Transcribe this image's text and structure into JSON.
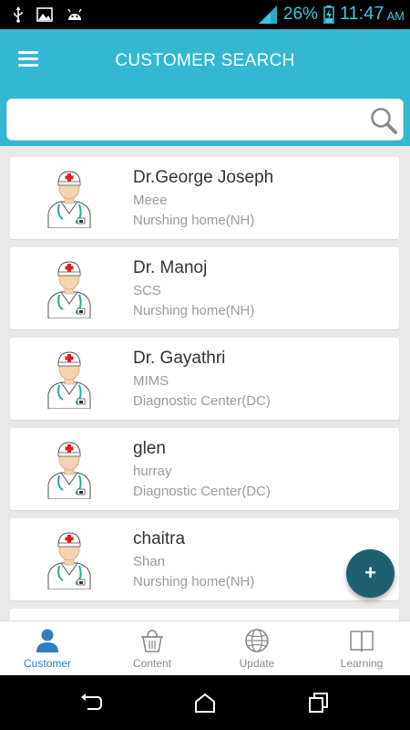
{
  "status_bar": {
    "battery_pct": "26%",
    "time": "11:47",
    "ampm": "AM"
  },
  "header": {
    "title": "CUSTOMER SEARCH"
  },
  "search": {
    "value": "",
    "placeholder": ""
  },
  "customers": [
    {
      "name": "Dr.George Joseph",
      "org": "Meee",
      "type": "Nurshing home(NH)"
    },
    {
      "name": "Dr. Manoj",
      "org": "SCS",
      "type": "Nurshing home(NH)"
    },
    {
      "name": "Dr. Gayathri",
      "org": "MIMS",
      "type": "Diagnostic Center(DC)"
    },
    {
      "name": "glen",
      "org": "hurray",
      "type": "Diagnostic Center(DC)"
    },
    {
      "name": "chaitra",
      "org": "Shan",
      "type": "Nurshing home(NH)"
    }
  ],
  "fab": {
    "label": "+"
  },
  "bottom_nav": [
    {
      "label": "Customer",
      "icon": "person-icon",
      "active": true
    },
    {
      "label": "Content",
      "icon": "basket-icon",
      "active": false
    },
    {
      "label": "Update",
      "icon": "globe-icon",
      "active": false
    },
    {
      "label": "Learning",
      "icon": "book-icon",
      "active": false
    }
  ],
  "colors": {
    "app_bar": "#33b8d3",
    "fab": "#1e6070",
    "active_nav": "#2d7fc2",
    "status_accent": "#3fc5e0"
  }
}
